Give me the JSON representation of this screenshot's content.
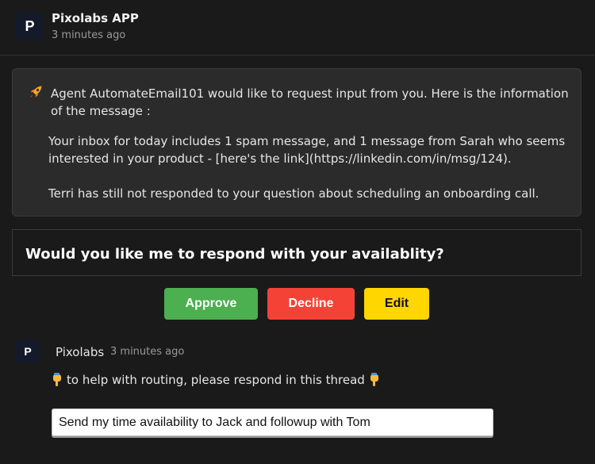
{
  "header": {
    "avatar_letter": "P",
    "app_name": "Pixolabs APP",
    "timestamp": "3 minutes ago"
  },
  "info_card": {
    "icon": "rocket-icon",
    "intro": "Agent AutomateEmail101 would like to request input from you. Here is the information of the message :",
    "paragraph_1": "Your inbox for today includes 1 spam message, and 1 message from Sarah who seems interested in your product - [here's the link](https://linkedin.com/in/msg/124).",
    "paragraph_2": "Terri has still not responded to your question about scheduling an onboarding call."
  },
  "question": "Would you like me to respond with your availablity?",
  "actions": {
    "approve_label": "Approve",
    "decline_label": "Decline",
    "edit_label": "Edit"
  },
  "thread": {
    "avatar_letter": "P",
    "author": "Pixolabs",
    "timestamp": "3 minutes ago",
    "routing_text": "to help with routing, please respond in this thread",
    "routing_icon": "pointing-down-hand-icon",
    "reply_value": "Send my time availability to Jack and followup with Tom"
  },
  "colors": {
    "background": "#1a1a1a",
    "card": "#2b2b2b",
    "approve": "#4caf50",
    "decline": "#f44336",
    "edit": "#ffd600"
  }
}
